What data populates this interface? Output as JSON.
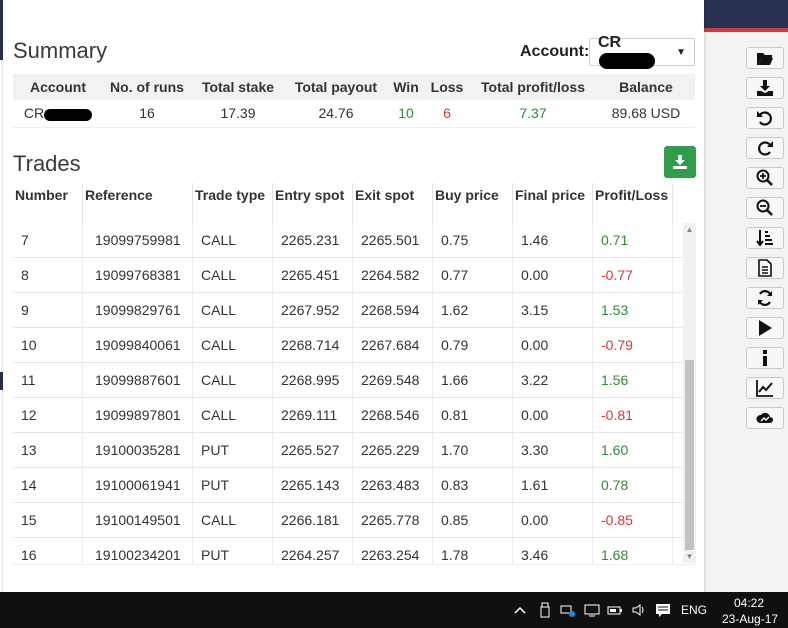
{
  "summary": {
    "title": "Summary",
    "account_label": "Account:",
    "account_value": "CR",
    "columns": [
      "Account",
      "No. of runs",
      "Total stake",
      "Total payout",
      "Win",
      "Loss",
      "Total profit/loss",
      "Balance"
    ],
    "row": {
      "account": "CR",
      "runs": "16",
      "stake": "17.39",
      "payout": "24.76",
      "win": "10",
      "loss": "6",
      "profit": "7.37",
      "balance": "89.68 USD"
    }
  },
  "trades": {
    "title": "Trades",
    "columns": [
      "Number",
      "Reference",
      "Trade type",
      "Entry spot",
      "Exit spot",
      "Buy price",
      "Final price",
      "Profit/Loss"
    ],
    "rows": [
      {
        "number": "7",
        "reference": "19099759981",
        "type": "CALL",
        "entry": "2265.231",
        "exit": "2265.501",
        "buy": "0.75",
        "final": "1.46",
        "pl": "0.71"
      },
      {
        "number": "8",
        "reference": "19099768381",
        "type": "CALL",
        "entry": "2265.451",
        "exit": "2264.582",
        "buy": "0.77",
        "final": "0.00",
        "pl": "-0.77"
      },
      {
        "number": "9",
        "reference": "19099829761",
        "type": "CALL",
        "entry": "2267.952",
        "exit": "2268.594",
        "buy": "1.62",
        "final": "3.15",
        "pl": "1.53"
      },
      {
        "number": "10",
        "reference": "19099840061",
        "type": "CALL",
        "entry": "2268.714",
        "exit": "2267.684",
        "buy": "0.79",
        "final": "0.00",
        "pl": "-0.79"
      },
      {
        "number": "11",
        "reference": "19099887601",
        "type": "CALL",
        "entry": "2268.995",
        "exit": "2269.548",
        "buy": "1.66",
        "final": "3.22",
        "pl": "1.56"
      },
      {
        "number": "12",
        "reference": "19099897801",
        "type": "CALL",
        "entry": "2269.111",
        "exit": "2268.546",
        "buy": "0.81",
        "final": "0.00",
        "pl": "-0.81"
      },
      {
        "number": "13",
        "reference": "19100035281",
        "type": "PUT",
        "entry": "2265.527",
        "exit": "2265.229",
        "buy": "1.70",
        "final": "3.30",
        "pl": "1.60"
      },
      {
        "number": "14",
        "reference": "19100061941",
        "type": "PUT",
        "entry": "2265.143",
        "exit": "2263.483",
        "buy": "0.83",
        "final": "1.61",
        "pl": "0.78"
      },
      {
        "number": "15",
        "reference": "19100149501",
        "type": "CALL",
        "entry": "2266.181",
        "exit": "2265.778",
        "buy": "0.85",
        "final": "0.00",
        "pl": "-0.85"
      },
      {
        "number": "16",
        "reference": "19100234201",
        "type": "PUT",
        "entry": "2264.257",
        "exit": "2263.254",
        "buy": "1.78",
        "final": "3.46",
        "pl": "1.68"
      }
    ]
  },
  "toolbar": {
    "icons": [
      "folder-open-icon",
      "download-icon",
      "undo-icon",
      "redo-icon",
      "zoom-in-icon",
      "zoom-out-icon",
      "sort-icon",
      "document-icon",
      "reset-icon",
      "play-icon",
      "info-icon",
      "chart-line-icon",
      "cloud-icon"
    ]
  },
  "taskbar": {
    "language": "ENG",
    "time": "04:22",
    "date": "23-Aug-17"
  },
  "colors": {
    "profit": "#2e8c36",
    "loss": "#d33a3a",
    "download_button": "#2e9e4a",
    "app_header": "#2a3052"
  }
}
